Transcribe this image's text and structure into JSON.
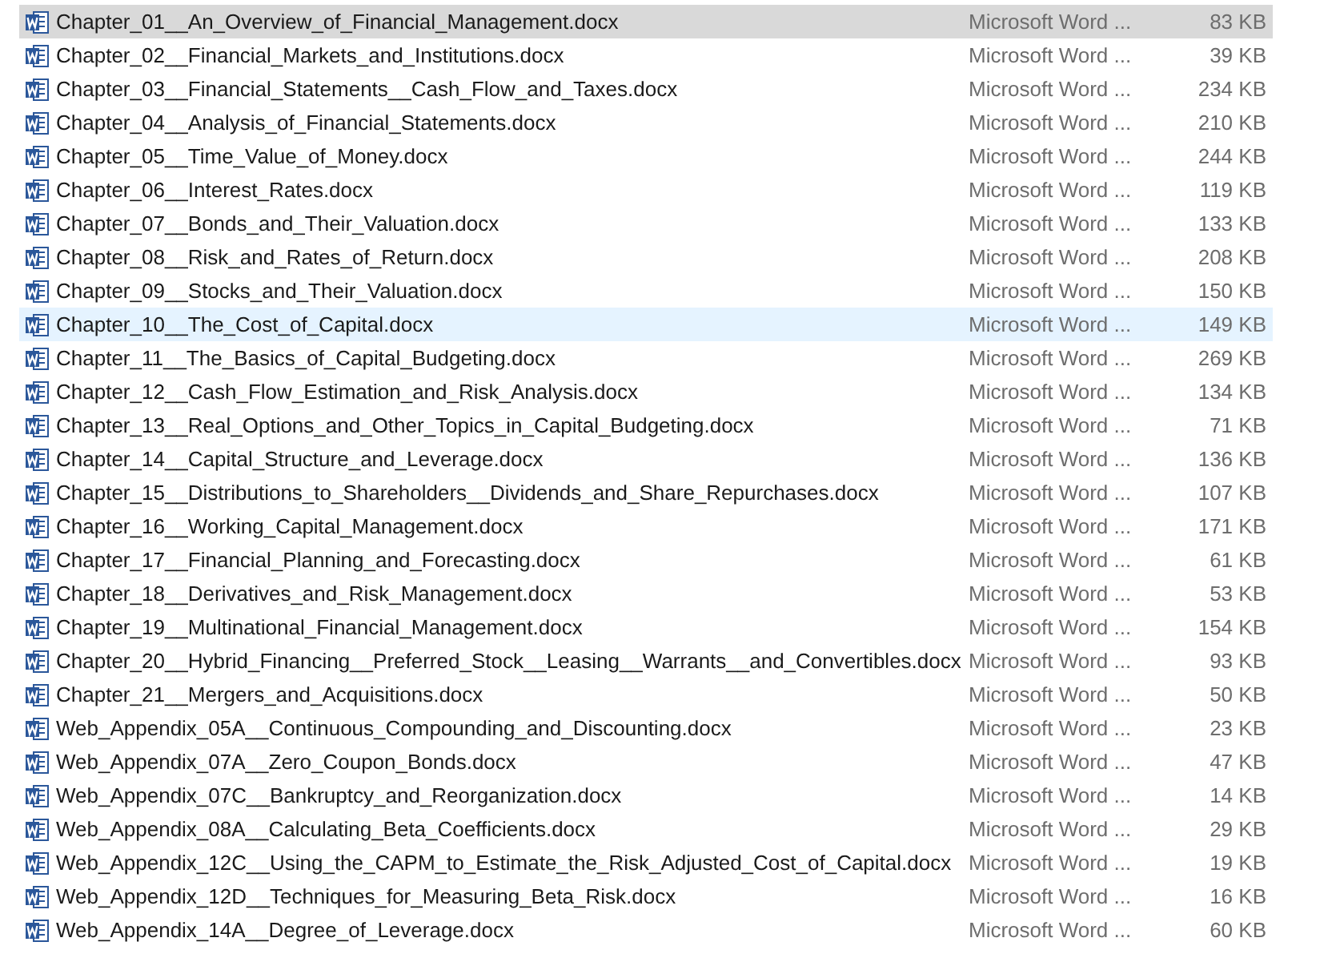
{
  "files": [
    {
      "name": "Chapter_01__An_Overview_of_Financial_Management.docx",
      "type": "Microsoft Word ...",
      "size": "83 KB",
      "selected": true,
      "hovered": false
    },
    {
      "name": "Chapter_02__Financial_Markets_and_Institutions.docx",
      "type": "Microsoft Word ...",
      "size": "39 KB",
      "selected": false,
      "hovered": false
    },
    {
      "name": "Chapter_03__Financial_Statements__Cash_Flow_and_Taxes.docx",
      "type": "Microsoft Word ...",
      "size": "234 KB",
      "selected": false,
      "hovered": false
    },
    {
      "name": "Chapter_04__Analysis_of_Financial_Statements.docx",
      "type": "Microsoft Word ...",
      "size": "210 KB",
      "selected": false,
      "hovered": false
    },
    {
      "name": "Chapter_05__Time_Value_of_Money.docx",
      "type": "Microsoft Word ...",
      "size": "244 KB",
      "selected": false,
      "hovered": false
    },
    {
      "name": "Chapter_06__Interest_Rates.docx",
      "type": "Microsoft Word ...",
      "size": "119 KB",
      "selected": false,
      "hovered": false
    },
    {
      "name": "Chapter_07__Bonds_and_Their_Valuation.docx",
      "type": "Microsoft Word ...",
      "size": "133 KB",
      "selected": false,
      "hovered": false
    },
    {
      "name": "Chapter_08__Risk_and_Rates_of_Return.docx",
      "type": "Microsoft Word ...",
      "size": "208 KB",
      "selected": false,
      "hovered": false
    },
    {
      "name": "Chapter_09__Stocks_and_Their_Valuation.docx",
      "type": "Microsoft Word ...",
      "size": "150 KB",
      "selected": false,
      "hovered": false
    },
    {
      "name": "Chapter_10__The_Cost_of_Capital.docx",
      "type": "Microsoft Word ...",
      "size": "149 KB",
      "selected": false,
      "hovered": true
    },
    {
      "name": "Chapter_11__The_Basics_of_Capital_Budgeting.docx",
      "type": "Microsoft Word ...",
      "size": "269 KB",
      "selected": false,
      "hovered": false
    },
    {
      "name": "Chapter_12__Cash_Flow_Estimation_and_Risk_Analysis.docx",
      "type": "Microsoft Word ...",
      "size": "134 KB",
      "selected": false,
      "hovered": false
    },
    {
      "name": "Chapter_13__Real_Options_and_Other_Topics_in_Capital_Budgeting.docx",
      "type": "Microsoft Word ...",
      "size": "71 KB",
      "selected": false,
      "hovered": false
    },
    {
      "name": "Chapter_14__Capital_Structure_and_Leverage.docx",
      "type": "Microsoft Word ...",
      "size": "136 KB",
      "selected": false,
      "hovered": false
    },
    {
      "name": "Chapter_15__Distributions_to_Shareholders__Dividends_and_Share_Repurchases.docx",
      "type": "Microsoft Word ...",
      "size": "107 KB",
      "selected": false,
      "hovered": false
    },
    {
      "name": "Chapter_16__Working_Capital_Management.docx",
      "type": "Microsoft Word ...",
      "size": "171 KB",
      "selected": false,
      "hovered": false
    },
    {
      "name": "Chapter_17__Financial_Planning_and_Forecasting.docx",
      "type": "Microsoft Word ...",
      "size": "61 KB",
      "selected": false,
      "hovered": false
    },
    {
      "name": "Chapter_18__Derivatives_and_Risk_Management.docx",
      "type": "Microsoft Word ...",
      "size": "53 KB",
      "selected": false,
      "hovered": false
    },
    {
      "name": "Chapter_19__Multinational_Financial_Management.docx",
      "type": "Microsoft Word ...",
      "size": "154 KB",
      "selected": false,
      "hovered": false
    },
    {
      "name": "Chapter_20__Hybrid_Financing__Preferred_Stock__Leasing__Warrants__and_Convertibles.docx",
      "type": "Microsoft Word ...",
      "size": "93 KB",
      "selected": false,
      "hovered": false
    },
    {
      "name": "Chapter_21__Mergers_and_Acquisitions.docx",
      "type": "Microsoft Word ...",
      "size": "50 KB",
      "selected": false,
      "hovered": false
    },
    {
      "name": "Web_Appendix_05A__Continuous_Compounding_and_Discounting.docx",
      "type": "Microsoft Word ...",
      "size": "23 KB",
      "selected": false,
      "hovered": false
    },
    {
      "name": "Web_Appendix_07A__Zero_Coupon_Bonds.docx",
      "type": "Microsoft Word ...",
      "size": "47 KB",
      "selected": false,
      "hovered": false
    },
    {
      "name": "Web_Appendix_07C__Bankruptcy_and_Reorganization.docx",
      "type": "Microsoft Word ...",
      "size": "14 KB",
      "selected": false,
      "hovered": false
    },
    {
      "name": "Web_Appendix_08A__Calculating_Beta_Coefficients.docx",
      "type": "Microsoft Word ...",
      "size": "29 KB",
      "selected": false,
      "hovered": false
    },
    {
      "name": "Web_Appendix_12C__Using_the_CAPM_to_Estimate_the_Risk_Adjusted_Cost_of_Capital.docx",
      "type": "Microsoft Word ...",
      "size": "19 KB",
      "selected": false,
      "hovered": false
    },
    {
      "name": "Web_Appendix_12D__Techniques_for_Measuring_Beta_Risk.docx",
      "type": "Microsoft Word ...",
      "size": "16 KB",
      "selected": false,
      "hovered": false
    },
    {
      "name": "Web_Appendix_14A__Degree_of_Leverage.docx",
      "type": "Microsoft Word ...",
      "size": "60 KB",
      "selected": false,
      "hovered": false
    }
  ]
}
